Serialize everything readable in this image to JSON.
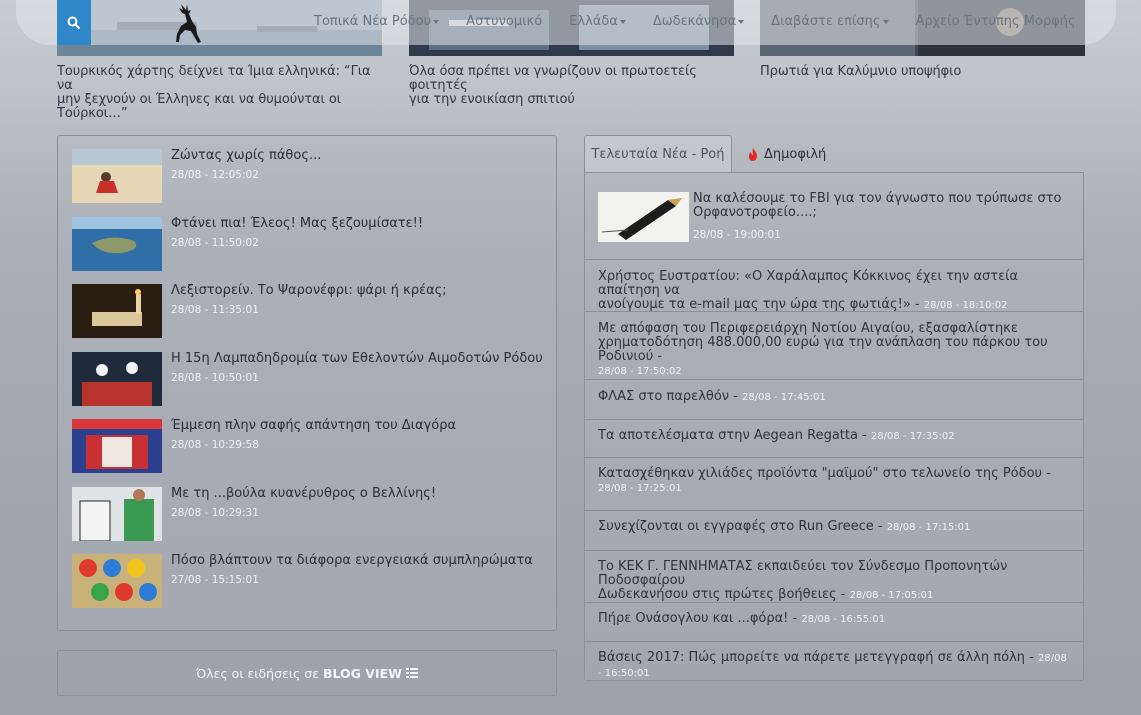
{
  "nav": {
    "items": [
      {
        "label": "Τοπικά Νέα Ρόδου",
        "caret": true
      },
      {
        "label": "Αστυνομικό",
        "caret": false
      },
      {
        "label": "Ελλάδα",
        "caret": true
      },
      {
        "label": "Δωδεκάνησα",
        "caret": true
      },
      {
        "label": "Διαβάστε επίσης",
        "caret": true
      },
      {
        "label": "Αρχείο Έντυπης Μορφής",
        "caret": false
      }
    ],
    "search_icon": "search-icon",
    "logo_icon": "deer-logo-icon"
  },
  "featured": [
    {
      "title_lines": [
        "Τουρκικός χάρτης δείχνει τα Ίμια ελληνικά: “Για να",
        "μην ξεχνούν οι Έλληνες και να θυμούνται οι",
        "Τούρκοι…”"
      ]
    },
    {
      "title_lines": [
        "Όλα όσα πρέπει να γνωρίζουν οι πρωτοετείς φοιτητές",
        "για την ενοικίαση σπιτιού"
      ]
    },
    {
      "title_lines": [
        "Πρωτιά για Καλύμνιο υποψήφιο"
      ]
    }
  ],
  "left_news": [
    {
      "title": "Ζώντας χωρίς πάθος...",
      "date": "28/08 - 12:05:02"
    },
    {
      "title": "Φτάνει πια! Έλεος! Μας ξεζουμίσατε!!",
      "date": "28/08 - 11:50:02"
    },
    {
      "title": "Λεξιστορείν. Το Ψαρονέφρι: ψάρι ή κρέας;",
      "date": "28/08 - 11:35:01"
    },
    {
      "title": "Η 15η Λαμπαδηδρομία των Εθελοντών Αιμοδοτών Ρόδου",
      "date": "28/08 - 10:50:01"
    },
    {
      "title": "Έμμεση πλην σαφής απάντηση του Διαγόρα",
      "date": "28/08 - 10:29:58"
    },
    {
      "title": "Με τη ...βούλα κυανέρυθρος ο Βελλίνης!",
      "date": "28/08 - 10:29:31"
    },
    {
      "title": "Πόσο βλάπτουν τα διάφορα ενεργειακά συμπληρώματα",
      "date": "27/08 - 15:15:01"
    }
  ],
  "blog_view": {
    "prefix": "Όλες οι ειδήσεις σε",
    "strong": "BLOG VIEW"
  },
  "tabs": {
    "latest": "Τελευταία Νέα - Ροή",
    "popular": "Δημοφιλή"
  },
  "feed_first": {
    "title": "Να καλέσουμε το FBI για τον άγνωστο που τρύπωσε στο Ορφανοτροφείο....;",
    "date": "28/08 - 19:00:01"
  },
  "feed": [
    {
      "lines": [
        "Χρήστος Ευστρατίου: «Ο Χαράλαμπος Κόκκινος έχει την αστεία απαίτηση να",
        "ανοίγουμε τα e-mail μας την ώρα της φωτιάς!» - "
      ],
      "date": "28/08 - 18:10:02"
    },
    {
      "lines": [
        "Με απόφαση του Περιφερειάρχη Νοτίου Αιγαίου, εξασφαλίστηκε",
        "χρηματοδότηση 488.000,00 ευρώ για την ανάπλαση του πάρκου του Ροδινιού - "
      ],
      "date": "28/08 - 17:50:02"
    },
    {
      "lines": [
        "ΦΛΑΣ στο παρελθόν - "
      ],
      "date": "28/08 - 17:45:01"
    },
    {
      "lines": [
        "Τα αποτελέσματα στην Aegean Regatta - "
      ],
      "date": "28/08 - 17:35:02"
    },
    {
      "lines": [
        "Κατασχέθηκαν χιλιάδες προϊόντα \"μαϊμού\" στο τελωνείο της Ρόδου - "
      ],
      "date": "28/08 - 17:25:01",
      "wrap_date": true
    },
    {
      "lines": [
        "Συνεχίζονται οι εγγραφές στο Run Greece - "
      ],
      "date": "28/08 - 17:15:01"
    },
    {
      "lines": [
        "Το ΚΕΚ Γ. ΓΕΝΝΗΜΑΤΑΣ εκπαιδεύει τον Σύνδεσμο Προπονητών Ποδοσφαίρου",
        "Δωδεκανήσου στις πρώτες βοήθειες - "
      ],
      "date": "28/08 - 17:05:01"
    },
    {
      "lines": [
        "Πήρε Ονάσογλου και ...φόρα! - "
      ],
      "date": "28/08 - 16:55:01"
    },
    {
      "lines": [
        "Βάσεις 2017: Πώς μπορείτε να πάρετε μετεγγραφή σε άλλη πόλη - "
      ],
      "date": "28/08 - 16:50:01"
    }
  ]
}
